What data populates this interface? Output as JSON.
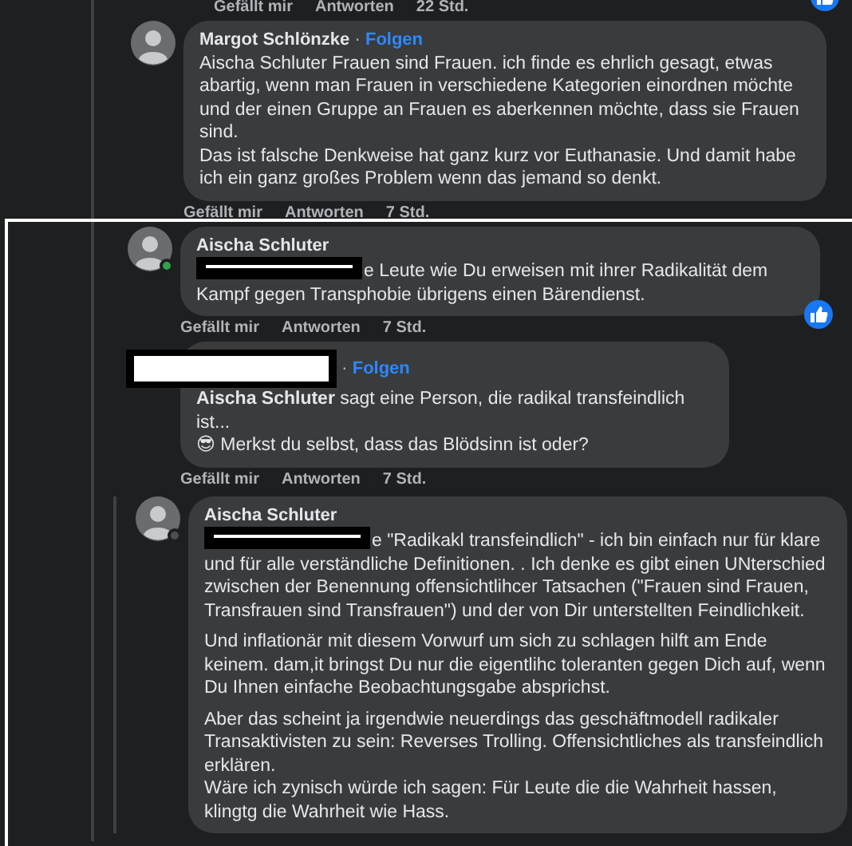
{
  "previous_actions": {
    "like": "Gefällt mir",
    "reply": "Antworten",
    "time": "22 Std.",
    "reaction": true
  },
  "comments": [
    {
      "author": "Margot Schlönzke",
      "separator": "·",
      "follow": "Folgen",
      "paragraphs": [
        "Aischa Schluter Frauen sind Frauen. ich finde es ehrlich gesagt, etwas abartig, wenn man Frauen in verschiedene Kategorien einordnen möchte und der einen Gruppe an Frauen es aberkennen möchte, dass sie Frauen sind.\nDas ist falsche Denkweise hat ganz kurz vor Euthanasie. Und damit habe ich ein ganz großes Problem wenn das jemand so denkt."
      ],
      "actions": {
        "like": "Gefällt mir",
        "reply": "Antworten",
        "time": "7 Std."
      }
    },
    {
      "author": "Aischa Schluter",
      "online": true,
      "body_redacted": true,
      "paragraphs": [
        "e Leute wie Du erweisen mit ihrer Radikalität dem Kampf gegen Transphobie übrigens einen Bärendienst."
      ],
      "actions": {
        "like": "Gefällt mir",
        "reply": "Antworten",
        "time": "7 Std."
      },
      "reaction": true
    },
    {
      "author_redacted": true,
      "separator": "·",
      "follow": "Folgen",
      "paragraphs": [
        "**Aischa Schluter** sagt eine Person, die radikal transfeindlich ist...\n😎 Merkst du selbst, dass das Blödsinn ist oder?"
      ],
      "actions": {
        "like": "Gefällt mir",
        "reply": "Antworten",
        "time": "7 Std."
      },
      "children": [
        {
          "author": "Aischa Schluter",
          "online": false,
          "body_redacted": true,
          "paragraphs": [
            "e \"Radikakl transfeindlich\" - ich bin einfach nur für klare und für alle verständliche Definitionen. . Ich denke es gibt einen UNterschied zwischen der Benennung offensichtlihcer Tatsachen (\"Frauen sind Frauen, Transfrauen sind Transfrauen\") und der von Dir unterstellten Feindlichkeit.",
            "Und inflationär mit diesem Vorwurf um sich zu schlagen hilft am Ende keinem. dam,it bringst Du nur die eigentlihc toleranten gegen Dich auf, wenn Du Ihnen einfache Beobachtungsgabe absprichst.",
            "Aber das scheint ja irgendwie neuerdings das geschäftmodell radikaler Transaktivisten zu sein: Reverses Trolling. Offensichtliches als transfeindlich erklären.\nWäre ich zynisch würde ich sagen: Für Leute die die Wahrheit hassen, klingtg die Wahrheit wie Hass."
          ]
        }
      ]
    }
  ]
}
